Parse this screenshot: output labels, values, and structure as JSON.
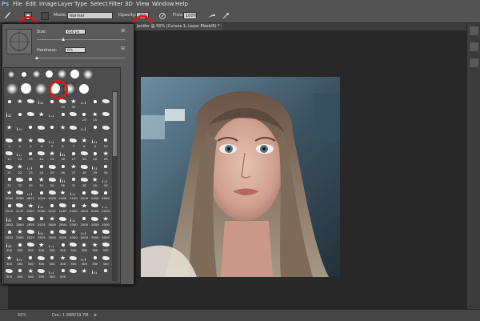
{
  "app": {
    "logo": "Ps"
  },
  "menu": [
    "File",
    "Edit",
    "Image",
    "Layer",
    "Type",
    "Select",
    "Filter",
    "3D",
    "View",
    "Window",
    "Help"
  ],
  "options_bar": {
    "mode_label": "Mode:",
    "mode_value": "Normal",
    "opacity_label": "Opacity:",
    "opacity_value": "20%",
    "flow_label": "Flow:",
    "flow_value": "100%"
  },
  "document_tab": "Jenifer @ 50% (Curves 1, Layer Mask/8) *",
  "brush_panel": {
    "size_label": "Size:",
    "size_value": "650 px",
    "hardness_label": "Hardness:",
    "hardness_value": "0%"
  },
  "brush_numbers": {
    "row1": [
      "",
      "",
      "",
      "",
      "",
      "25",
      "50",
      "",
      "",
      ""
    ],
    "row2": [
      "",
      "",
      "",
      "",
      "",
      "",
      "",
      "25",
      "25",
      ""
    ],
    "row3": [
      "",
      "",
      "",
      "",
      "",
      "",
      "",
      "",
      "",
      ""
    ],
    "row4": [
      "1",
      "2",
      "3",
      "4",
      "5",
      "6",
      "7",
      "8",
      "9",
      "10"
    ],
    "row5": [
      "11",
      "12",
      "13",
      "14",
      "15",
      "16",
      "17",
      "18",
      "19",
      "20"
    ],
    "row6": [
      "21",
      "22",
      "23",
      "24",
      "25",
      "26",
      "27",
      "28",
      "29",
      "30"
    ],
    "row7": [
      "31",
      "32",
      "33",
      "34",
      "35",
      "36",
      "37",
      "38",
      "39",
      "40"
    ],
    "row8": [
      "5000",
      "5000",
      "4671",
      "1025",
      "1000",
      "1200",
      "1100",
      "2000",
      "2000",
      "5000"
    ],
    "row9": [
      "2012",
      "2147",
      "2467",
      "2000",
      "2222",
      "1467",
      "2000",
      "2000",
      "2000",
      "2000"
    ],
    "row10": [
      "2822",
      "2800",
      "2850",
      "2925",
      "3000",
      "2844",
      "2000",
      "2000",
      "2000",
      "2000"
    ],
    "row11": [
      "2822",
      "2800",
      "2820",
      "2925",
      "3000",
      "3000",
      "2000",
      "2000",
      "3000",
      "3000"
    ],
    "row12": [
      "300",
      "300",
      "300",
      "300",
      "300",
      "300",
      "300",
      "300",
      "300",
      "300"
    ],
    "row13": [
      "300",
      "300",
      "300",
      "300",
      "300",
      "300",
      "300",
      "300",
      "300",
      "300"
    ],
    "row14": [
      "300",
      "300",
      "300",
      "300",
      "300",
      "300",
      "",
      "",
      "",
      ""
    ]
  },
  "status_bar": {
    "zoom": "50%",
    "doc": "Doc: 1.98M/19.7M"
  }
}
